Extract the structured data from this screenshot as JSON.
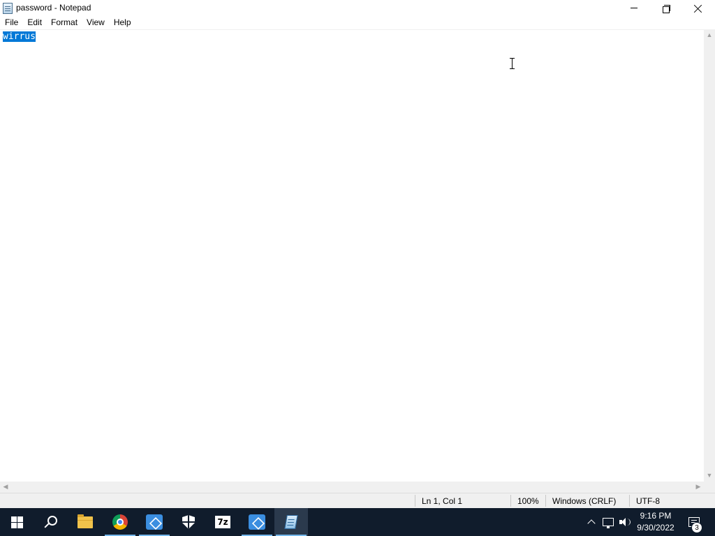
{
  "window": {
    "title": "password - Notepad",
    "icon": "notepad-icon"
  },
  "menu": {
    "items": [
      "File",
      "Edit",
      "Format",
      "View",
      "Help"
    ]
  },
  "editor": {
    "text": "wirrus",
    "selected_text": "wirrus"
  },
  "status": {
    "position": "Ln 1, Col 1",
    "zoom": "100%",
    "line_endings": "Windows (CRLF)",
    "encoding": "UTF-8"
  },
  "taskbar": {
    "apps": [
      "start-icon",
      "search-icon",
      "file-explorer-icon",
      "chrome-icon",
      "app-box-icon",
      "security-shield-icon",
      "7zip-icon",
      "app-box-icon",
      "notepad-icon"
    ],
    "sevenzip_label": "7z",
    "clock_time": "9:16 PM",
    "clock_date": "9/30/2022",
    "notification_count": "3"
  },
  "colors": {
    "selection": "#0078d7",
    "taskbar": "#101c2c",
    "active_underline": "#76b9ed"
  }
}
